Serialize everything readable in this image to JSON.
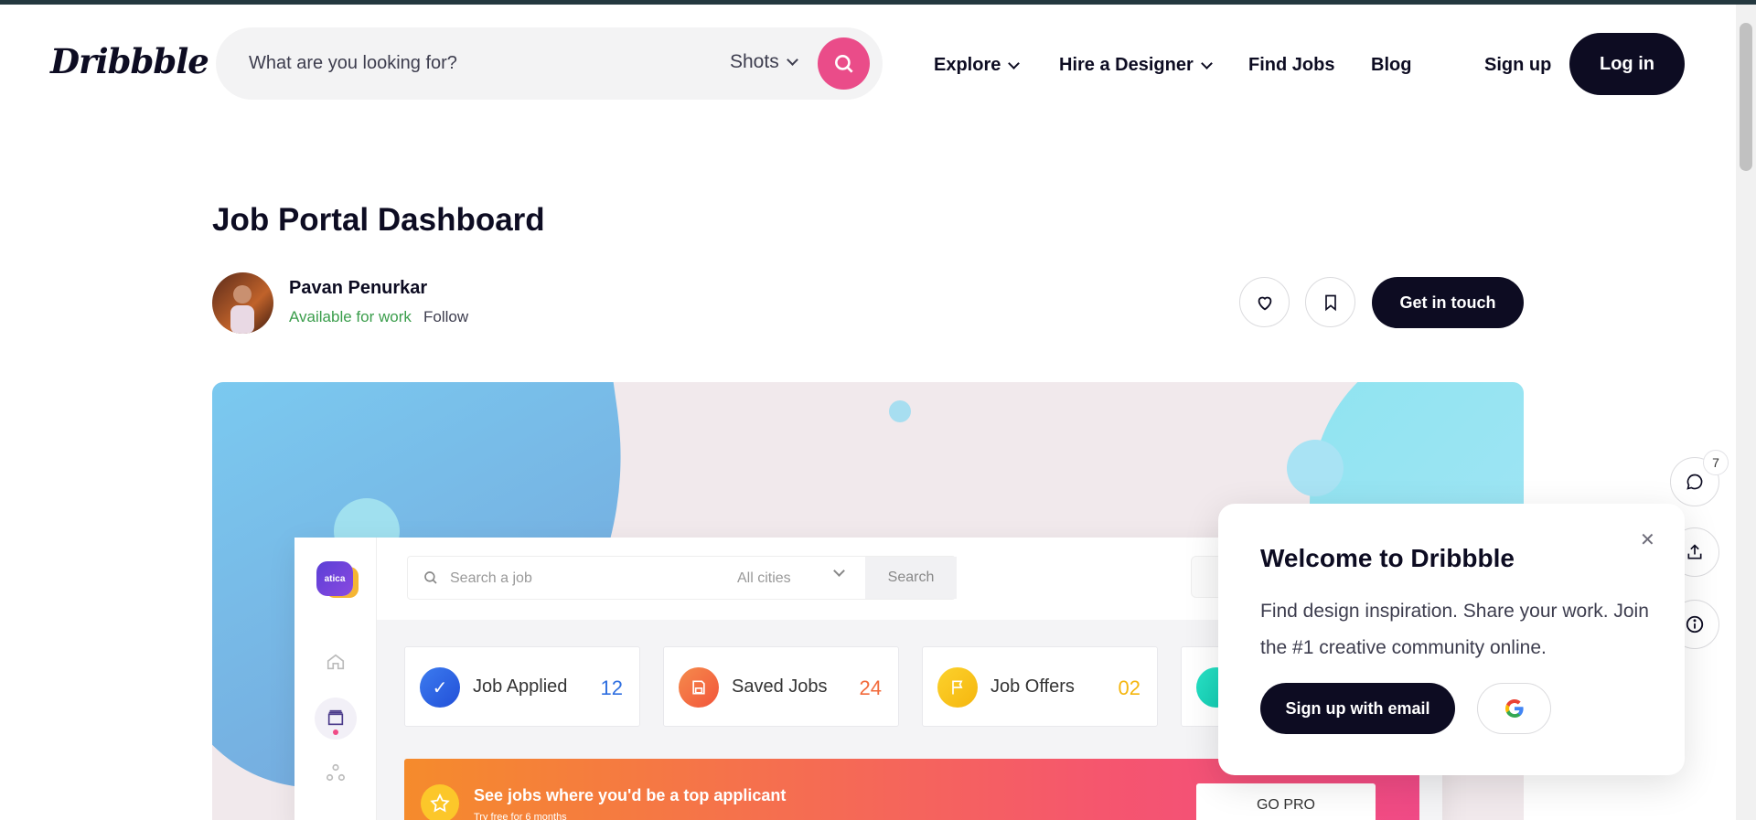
{
  "header": {
    "logo": "Dribbble",
    "search": {
      "placeholder": "What are you looking for?",
      "category": "Shots"
    },
    "nav": [
      "Explore",
      "Hire a Designer",
      "Find Jobs",
      "Blog"
    ],
    "signup": "Sign up",
    "login": "Log in"
  },
  "shot": {
    "title": "Job Portal Dashboard",
    "author": "Pavan Penurkar",
    "availability": "Available for work",
    "follow": "Follow",
    "get_in_touch": "Get in touch"
  },
  "preview": {
    "logo": "atica",
    "search_placeholder": "Search a job",
    "city": "All cities",
    "search_button": "Search",
    "stats": [
      {
        "label": "Job Applied",
        "value": "12",
        "color": "#2f6fe0"
      },
      {
        "label": "Saved Jobs",
        "value": "24",
        "color": "#f26a3b"
      },
      {
        "label": "Job Offers",
        "value": "02",
        "color": "#f5b60f"
      }
    ],
    "banner": {
      "title": "See jobs where you'd be a top applicant",
      "subtitle": "Try free for 6 months",
      "cta": "GO PRO"
    }
  },
  "rail": {
    "comment_count": "7"
  },
  "modal": {
    "title": "Welcome to Dribbble",
    "text": "Find design inspiration. Share your work. Join the #1 creative community online.",
    "signup_email": "Sign up with email"
  },
  "colors": {
    "brand_pink": "#ea4c89",
    "dark": "#0d0c22",
    "available_green": "#3a9d4b"
  }
}
